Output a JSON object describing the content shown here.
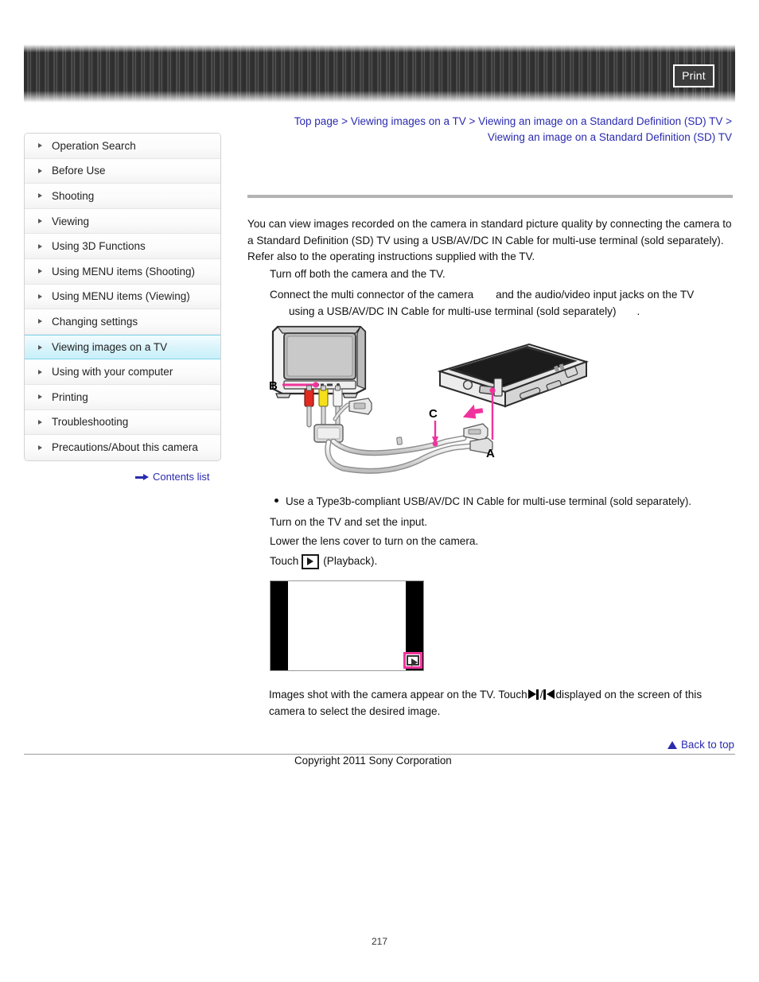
{
  "header": {
    "print_label": "Print"
  },
  "breadcrumb": {
    "text": "Top page > Viewing images on a TV > Viewing an image on a Standard Definition (SD) TV > Viewing an image on a Standard Definition (SD) TV"
  },
  "sidebar": {
    "items": [
      {
        "label": "Operation Search",
        "active": false
      },
      {
        "label": "Before Use",
        "active": false
      },
      {
        "label": "Shooting",
        "active": false
      },
      {
        "label": "Viewing",
        "active": false
      },
      {
        "label": "Using 3D Functions",
        "active": false
      },
      {
        "label": "Using MENU items (Shooting)",
        "active": false
      },
      {
        "label": "Using MENU items (Viewing)",
        "active": false
      },
      {
        "label": "Changing settings",
        "active": false
      },
      {
        "label": "Viewing images on a TV",
        "active": true
      },
      {
        "label": "Using with your computer",
        "active": false
      },
      {
        "label": "Printing",
        "active": false
      },
      {
        "label": "Troubleshooting",
        "active": false
      },
      {
        "label": "Precautions/About this camera",
        "active": false
      }
    ],
    "contents_list_label": "Contents list"
  },
  "main": {
    "intro": "You can view images recorded on the camera in standard picture quality by connecting the camera to a Standard Definition (SD) TV using a USB/AV/DC IN Cable for multi-use terminal (sold separately). Refer also to the operating instructions supplied with the TV.",
    "step1": "Turn off both the camera and the TV.",
    "step2_part1": "Connect the multi connector of the camera",
    "step2_part2": "and the audio/video input jacks on the TV",
    "step2_part3": "using a USB/AV/DC IN Cable for multi-use terminal (sold separately)",
    "step2_part4": ".",
    "note": "Use a Type3b-compliant USB/AV/DC IN Cable for multi-use terminal (sold separately).",
    "step3": "Turn on the TV and set the input.",
    "step4": "Lower the lens cover to turn on the camera.",
    "step5_prefix": "Touch",
    "step5_suffix": "(Playback).",
    "closing_part1": "Images shot with the camera appear on the TV. Touch",
    "closing_separator": "/",
    "closing_part2": "displayed on the screen of this camera to select the desired image."
  },
  "diagram": {
    "label_a": "A",
    "label_b": "B",
    "label_c": "C",
    "callout_color": "#f0339c",
    "rca_red": "#e02b20",
    "rca_yellow": "#f5e01a",
    "rca_white": "#f2f2f2"
  },
  "footer": {
    "back_to_top_label": "Back to top",
    "copyright": "Copyright 2011 Sony Corporation",
    "page_number": "217"
  }
}
